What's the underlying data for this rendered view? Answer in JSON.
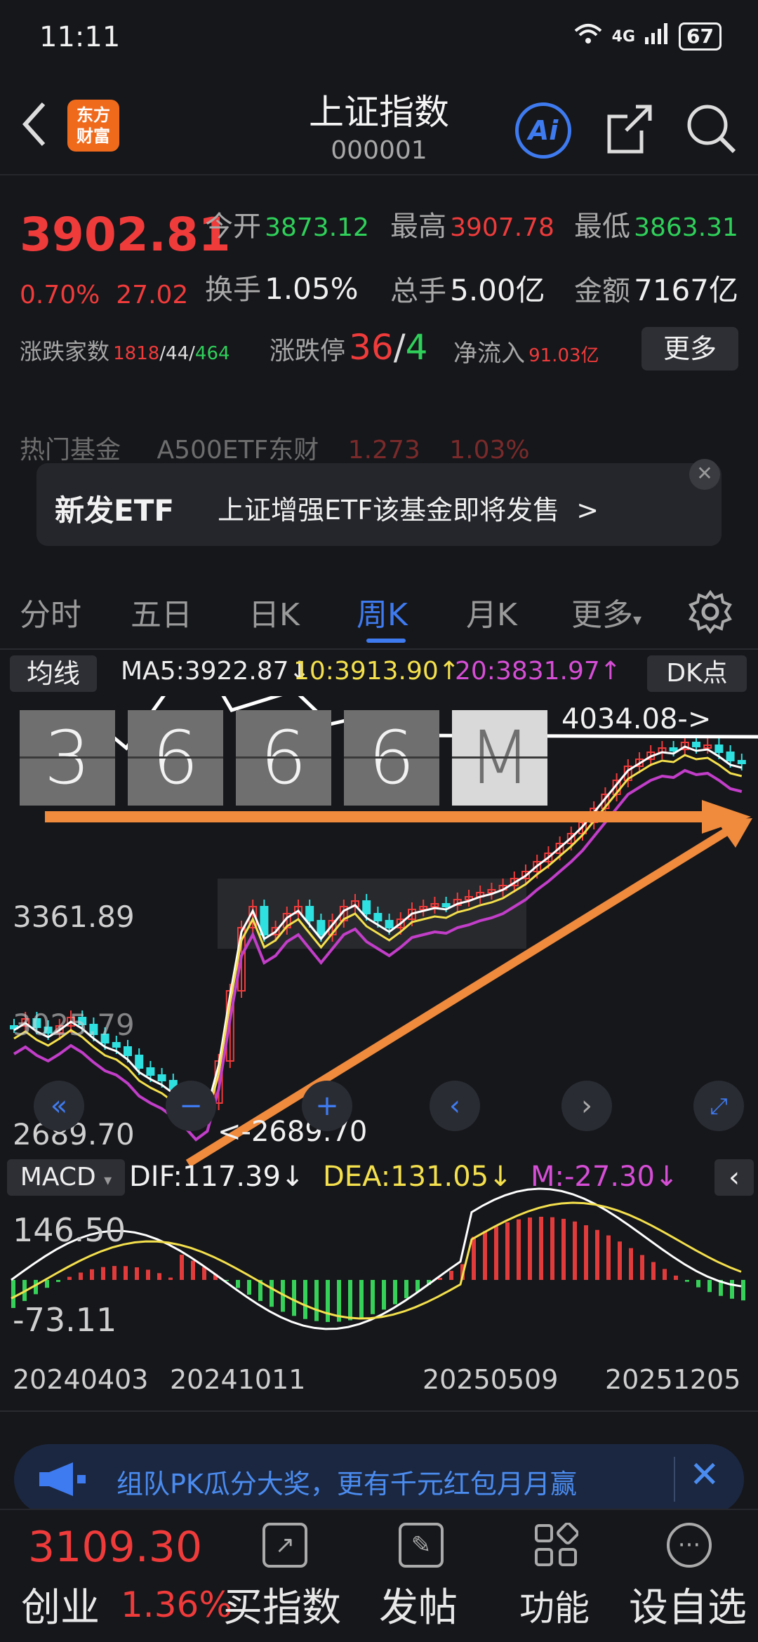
{
  "status_bar": {
    "time": "11:11",
    "network": "4G",
    "battery": "67"
  },
  "nav": {
    "logo": [
      "东方",
      "财富"
    ],
    "title": "上证指数",
    "code": "000001",
    "ai_label": "Ai"
  },
  "quote": {
    "price": "3902.81",
    "change_pct": "0.70%",
    "change_abs": "27.02",
    "open_label": "今开",
    "open": "3873.12",
    "high_label": "最高",
    "high": "3907.78",
    "low_label": "最低",
    "low": "3863.31",
    "turnover_label": "换手",
    "turnover": "1.05%",
    "volume_label": "总手",
    "volume": "5.00亿",
    "amount_label": "金额",
    "amount": "7167亿",
    "breadth_label": "涨跌家数",
    "breadth_up": "1818",
    "breadth_flat": "44",
    "breadth_down": "464",
    "limit_label": "涨跌停",
    "limit_up": "36",
    "limit_down": "4",
    "netflow_label": "净流入",
    "netflow": "91.03亿",
    "more_label": "更多"
  },
  "hot_fund": {
    "label": "热门基金",
    "name": "A500ETF东财",
    "price": "1.273",
    "pct": "1.03%"
  },
  "banner": {
    "tag": "新发ETF",
    "message": "上证增强ETF该基金即将发售",
    "arrow": ">"
  },
  "tabs": [
    "分时",
    "五日",
    "日K",
    "周K",
    "月K",
    "更多"
  ],
  "active_tab": "周K",
  "ma_row": {
    "label": "均线",
    "ma5": "MA5:3922.87↓",
    "ma10": "10:3913.90↑",
    "ma20": "20:3831.97↑",
    "dk_label": "DK点"
  },
  "overlay_counter": [
    "3",
    "6",
    "6",
    "6",
    "M"
  ],
  "chart_data": {
    "type": "candlestick",
    "y_ticks": [
      "4034.08",
      "3361.89",
      "3025.79",
      "2689.70"
    ],
    "high_annotation": "4034.08->",
    "low_annotation": "<-2689.70",
    "x_ticks": [
      "20240403",
      "20241011",
      "20250509",
      "20251205"
    ],
    "ylim": [
      2689.7,
      4034.08
    ]
  },
  "macd": {
    "label": "MACD",
    "dif": "DIF:117.39↓",
    "dea": "DEA:131.05↓",
    "m": "M:-27.30↓",
    "y_ticks": [
      "146.50",
      "-73.11"
    ]
  },
  "promo": {
    "text": "组队PK瓜分大奖，更有千元红包月月赢"
  },
  "bottom": {
    "index_value": "3109.30",
    "index_name": "创业",
    "index_pct": "1.36%",
    "items": [
      "买指数",
      "发帖",
      "功能",
      "设自选"
    ]
  },
  "colors": {
    "up": "#f03b3b",
    "down": "#2fd15a",
    "accent": "#3f7bf0",
    "arrow": "#f08a3c"
  }
}
